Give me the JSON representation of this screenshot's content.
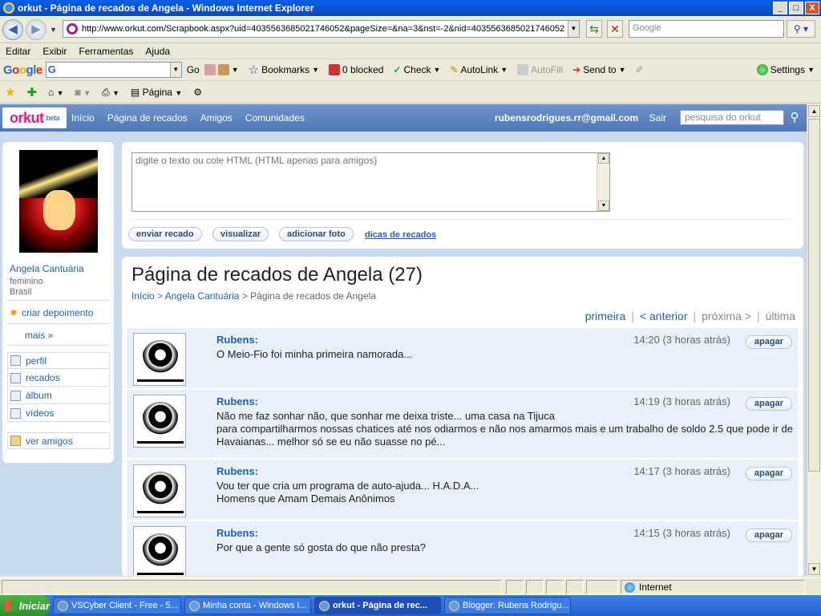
{
  "window": {
    "title": "orkut - Página de recados de Angela - Windows Internet Explorer",
    "buttons": {
      "minimize": "_",
      "maximize": "□",
      "close": "X"
    }
  },
  "browser": {
    "url": "http://www.orkut.com/Scrapbook.aspx?uid=4035563685021746052&pageSize=&na=3&nst=-2&nid=4035563685021746052",
    "search_placeholder": "Google",
    "menu": [
      "Editar",
      "Exibir",
      "Ferramentas",
      "Ajuda"
    ],
    "google_toolbar": {
      "logo": "Google",
      "go": "Go",
      "bookmarks": "Bookmarks",
      "blocked": "0 blocked",
      "check": "Check",
      "autolink": "AutoLink",
      "autofill": "AutoFill",
      "sendto": "Send to",
      "settings": "Settings"
    },
    "fav_toolbar": {
      "page": "Página"
    },
    "status": {
      "zone": "Internet"
    }
  },
  "orkut": {
    "logo": "orkut",
    "logo_suffix": "beta",
    "nav": [
      "Início",
      "Página de recados",
      "Amigos",
      "Comunidades"
    ],
    "user_email": "rubensrodrigues.rr@gmail.com",
    "logout": "Sair",
    "search_placeholder": "pesquisa do orkut"
  },
  "profile": {
    "name": "Angela Cantuária",
    "gender": "feminino",
    "country": "Brasil",
    "create_testimonial": "criar depoimento",
    "more": "mais »",
    "menu": [
      "perfil",
      "recados",
      "álbum",
      "vídeos"
    ],
    "friends": "ver amigos"
  },
  "composer": {
    "placeholder": "digite o texto ou cole HTML (HTML apenas para amigos)",
    "send": "enviar recado",
    "preview": "visualizar",
    "add_photo": "adicionar foto",
    "tips": "dicas de recados"
  },
  "scrapbook": {
    "title": "Página de recados de Angela (27)",
    "breadcrumb": {
      "home": "Início",
      "profile": "Angela Cantuária",
      "current": "Página de recados de Angela",
      "separator": ">"
    },
    "pager": {
      "first": "primeira",
      "prev": "< anterior",
      "next": "próxima >",
      "last": "última",
      "sep": "|"
    },
    "delete_label": "apagar",
    "scraps": [
      {
        "author": "Rubens:",
        "time": "14:20 (3 horas atrás)",
        "text": "O Meio-Fio foi minha primeira namorada..."
      },
      {
        "author": "Rubens:",
        "time": "14:19 (3 horas atrás)",
        "text": "Não me faz sonhar não, que sonhar me deixa triste... uma casa na Tijuca\npara compartilharmos nossas chatices até nos odiarmos e não nos amarmos mais e um trabalho de soldo 2.5 que pode ir de Havaianas... melhor só se eu não suasse no pé..."
      },
      {
        "author": "Rubens:",
        "time": "14:17 (3 horas atrás)",
        "text": "Vou ter que cria um programa de auto-ajuda... H.A.D.A...\nHomens que Amam Demais Anônimos"
      },
      {
        "author": "Rubens:",
        "time": "14:15 (3 horas atrás)",
        "text": "Por que a gente só gosta do que não presta?"
      }
    ]
  },
  "taskbar": {
    "start": "Iniciar",
    "items": [
      "VSCyber Client - Free - 5...",
      "Minha conta - Windows I...",
      "orkut - Página de rec...",
      "Blogger: Rubens Rodrigu..."
    ]
  },
  "colors": {
    "orkut_bar": "#5D82C0",
    "orkut_pink": "#E8178A",
    "link": "#2660A8",
    "scrap_bg": "#E8F0FA",
    "page_bg": "#C9DAEE"
  }
}
